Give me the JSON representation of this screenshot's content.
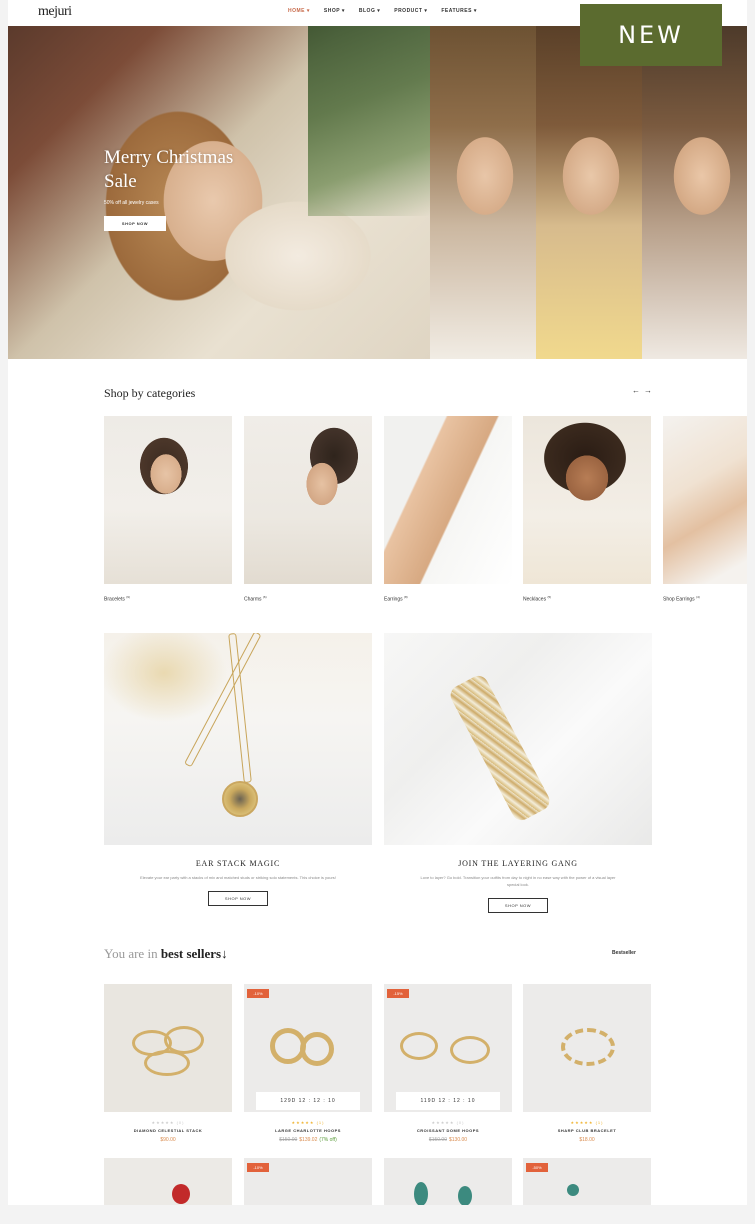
{
  "header": {
    "logo": "mejuri",
    "nav": [
      "HOME ▾",
      "SHOP ▾",
      "BLOG ▾",
      "PRODUCT ▾",
      "FEATURES ▾"
    ],
    "badge": "NEW"
  },
  "hero": {
    "title": "Merry Christmas Sale",
    "subtitle": "50% off all jewelry cases",
    "button": "SHOP NOW"
  },
  "categories": {
    "title": "Shop by categories",
    "prev": "←",
    "next": "→",
    "items": [
      {
        "label": "Bracelets",
        "count": "(9)"
      },
      {
        "label": "Charms",
        "count": "(6)"
      },
      {
        "label": "Earrings",
        "count": "(8)"
      },
      {
        "label": "Necklaces",
        "count": "(5)"
      },
      {
        "label": "Shop Earrings",
        "count": "(4)"
      }
    ]
  },
  "promos": [
    {
      "title": "EAR STACK MAGIC",
      "desc": "Elevate your ear party with a stacks of mix and matched studs or striking solo statements. This choice is yours!",
      "button": "SHOP NOW"
    },
    {
      "title": "JOIN THE LAYERING GANG",
      "desc": "Love to layer? Go bold. Transition your outfits from day to night in no ease way with the power of a visual layer special look.",
      "button": "SHOP NOW"
    }
  ],
  "best_sellers": {
    "prefix": "You are in",
    "title": "best sellers",
    "arrow": "↓",
    "link": "Bestseller",
    "products": [
      {
        "name": "DIAMOND CELESTIAL STACK",
        "price": "$90.00",
        "old_price": "",
        "save": "",
        "sale": "",
        "timer": "",
        "stars": "★★★★★ (0)",
        "rated": false
      },
      {
        "name": "LARGE CHARLOTTE HOOPS",
        "price": "$139.02",
        "old_price": "$150.00",
        "save": "(7% off)",
        "sale": "-10%",
        "timer": "129D  12 : 12 : 10",
        "stars": "★★★★★ (1)",
        "rated": true
      },
      {
        "name": "CROISSANT DOME HOOPS",
        "price": "$130.00",
        "old_price": "$150.00",
        "save": "",
        "sale": "-15%",
        "timer": "119D  12 : 12 : 10",
        "stars": "★★★★★ (0)",
        "rated": false
      },
      {
        "name": "SHARP CLUB BRACELET",
        "price": "$18.00",
        "old_price": "",
        "save": "",
        "sale": "",
        "timer": "",
        "stars": "★★★★★ (1)",
        "rated": true
      }
    ],
    "row2_sale": [
      "",
      "-10%",
      "",
      "-50%"
    ]
  },
  "colors": {
    "badge": "#5b6b2f",
    "accent": "#e2623b",
    "price": "#d98a4c"
  }
}
